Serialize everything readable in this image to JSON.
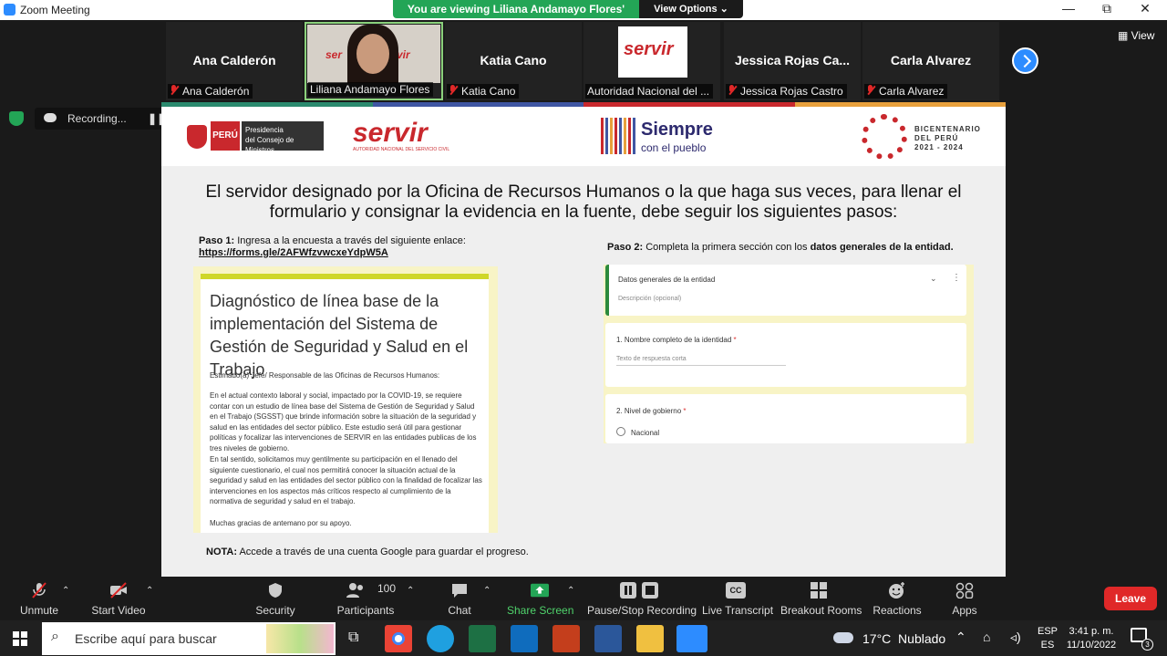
{
  "window": {
    "title": "Zoom Meeting",
    "minimize": "—",
    "restore": "⧉",
    "close": "✕"
  },
  "banner": {
    "viewing": "You are viewing Liliana Andamayo Flores' screen",
    "view_options": "View Options ⌄"
  },
  "participants": [
    {
      "name": "Ana Calderón",
      "label": "Ana Calderón",
      "muted": true
    },
    {
      "name": "",
      "label": "Liliana Andamayo Flores",
      "muted": false
    },
    {
      "name": "Katia Cano",
      "label": "Katia Cano",
      "muted": true
    },
    {
      "name": "",
      "label": "Autoridad Nacional del ...",
      "muted": false
    },
    {
      "name": "Jessica Rojas Ca...",
      "label": "Jessica Rojas Castro",
      "muted": true
    },
    {
      "name": "Carla Alvarez",
      "label": "Carla Alvarez",
      "muted": true
    }
  ],
  "view_button": "View",
  "recording": "Recording...",
  "slide": {
    "peru": "PERÚ",
    "pcm": "Presidencia\ndel Consejo de Ministros",
    "servir": "servir",
    "servir_sub": "AUTORIDAD NACIONAL DEL SERVICIO CIVIL",
    "siempre": "Siempre",
    "siempre_sub": "con el pueblo",
    "bicentenario": "BICENTENARIO\nDEL PERÚ\n2021 - 2024",
    "title": "El servidor designado por la Oficina de Recursos Humanos o la que haga sus veces, para llenar el formulario y consignar la evidencia en la fuente, debe seguir los siguientes pasos:",
    "paso1_label": "Paso 1:",
    "paso1_text": " Ingresa a la encuesta a través del siguiente enlace:",
    "paso1_link": "https://forms.gle/2AFWfzvwcxeYdpW5A",
    "paso2_label": "Paso 2:",
    "paso2_text": " Completa la primera sección con los ",
    "paso2_bold": "datos generales de la entidad.",
    "form_title": "Diagnóstico de línea base de la implementación del Sistema de Gestión de Seguridad y Salud en el Trabajo",
    "form_p1": "Estimado(a) Jefe/ Responsable de las Oficinas de Recursos Humanos:",
    "form_p2": "En el actual contexto laboral y social, impactado por la COVID-19, se requiere contar con un estudio de línea base del Sistema de Gestión de Seguridad y Salud en el Trabajo (SGSST) que brinde información sobre la situación de la seguridad y salud en las entidades del sector público. Este estudio será útil para gestionar políticas y focalizar las intervenciones de SERVIR en las entidades publicas de los tres niveles de gobierno.",
    "form_p3": "En tal sentido, solicitamos muy gentilmente su participación en el llenado del siguiente cuestionario, el cual nos permitirá conocer la situación actual de la seguridad y salud en las entidades del sector público con la finalidad de focalizar las intervenciones en los aspectos más críticos respecto al cumplimiento de la normativa de seguridad y salud en el trabajo.",
    "form_p4": "Muchas gracias de antemano por su apoyo.",
    "r1_title": "Datos generales de la entidad",
    "r1_desc": "Descripción (opcional)",
    "r2_title": "1. Nombre completo de la identidad",
    "r2_placeholder": "Texto de respuesta corta",
    "r3_title": "2. Nivel de gobierno",
    "r3_option": "Nacional",
    "required_mark": "*",
    "nota_label": "NOTA:",
    "nota_text": " Accede a través de una cuenta Google para guardar el progreso."
  },
  "toolbar": {
    "unmute": "Unmute",
    "start_video": "Start Video",
    "security": "Security",
    "participants": "Participants",
    "participants_count": "100",
    "chat": "Chat",
    "share_screen": "Share Screen",
    "pause_stop": "Pause/Stop Recording",
    "live_transcript": "Live Transcript",
    "cc": "CC",
    "breakout": "Breakout Rooms",
    "reactions": "Reactions",
    "apps": "Apps",
    "leave": "Leave"
  },
  "taskbar": {
    "search_placeholder": "Escribe aquí para buscar",
    "weather": "17°C  Nublado",
    "lang1": "ESP",
    "lang2": "ES",
    "time": "3:41 p. m.",
    "date": "11/10/2022",
    "notif_count": "3"
  },
  "colors": {
    "zoom_blue": "#2d8cff",
    "banner_green": "#23a556",
    "leave_red": "#e02828",
    "share_green": "#23a556"
  }
}
